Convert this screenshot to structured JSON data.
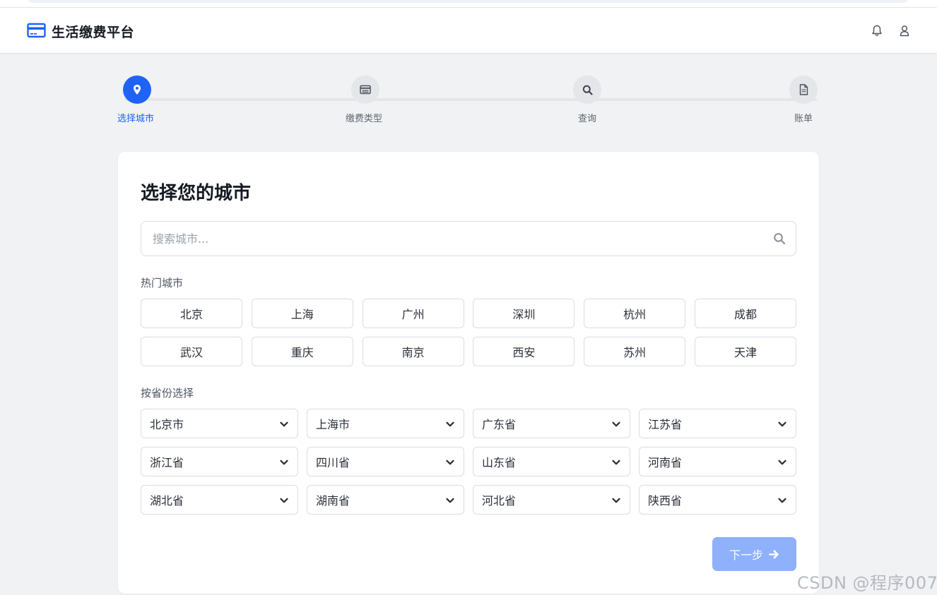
{
  "app": {
    "title": "生活缴费平台",
    "brand_icon": "credit-card-icon",
    "header_icons": [
      "bell-icon",
      "user-icon"
    ]
  },
  "steps": [
    {
      "label": "选择城市",
      "icon": "map-pin-icon",
      "active": true
    },
    {
      "label": "缴费类型",
      "icon": "list-card-icon",
      "active": false
    },
    {
      "label": "查询",
      "icon": "search-icon",
      "active": false
    },
    {
      "label": "账单",
      "icon": "document-icon",
      "active": false
    }
  ],
  "card": {
    "title": "选择您的城市",
    "search_placeholder": "搜索城市...",
    "hot_label": "热门城市",
    "hot_cities": [
      "北京",
      "上海",
      "广州",
      "深圳",
      "杭州",
      "成都",
      "武汉",
      "重庆",
      "南京",
      "西安",
      "苏州",
      "天津"
    ],
    "province_label": "按省份选择",
    "provinces": [
      "北京市",
      "上海市",
      "广东省",
      "江苏省",
      "浙江省",
      "四川省",
      "山东省",
      "河南省",
      "湖北省",
      "湖南省",
      "河北省",
      "陕西省"
    ],
    "next_label": "下一步"
  },
  "watermark": "CSDN @程序007",
  "colors": {
    "accent": "#1f63f5",
    "accent_disabled": "#8fb0fb",
    "background": "#f1f2f4"
  }
}
